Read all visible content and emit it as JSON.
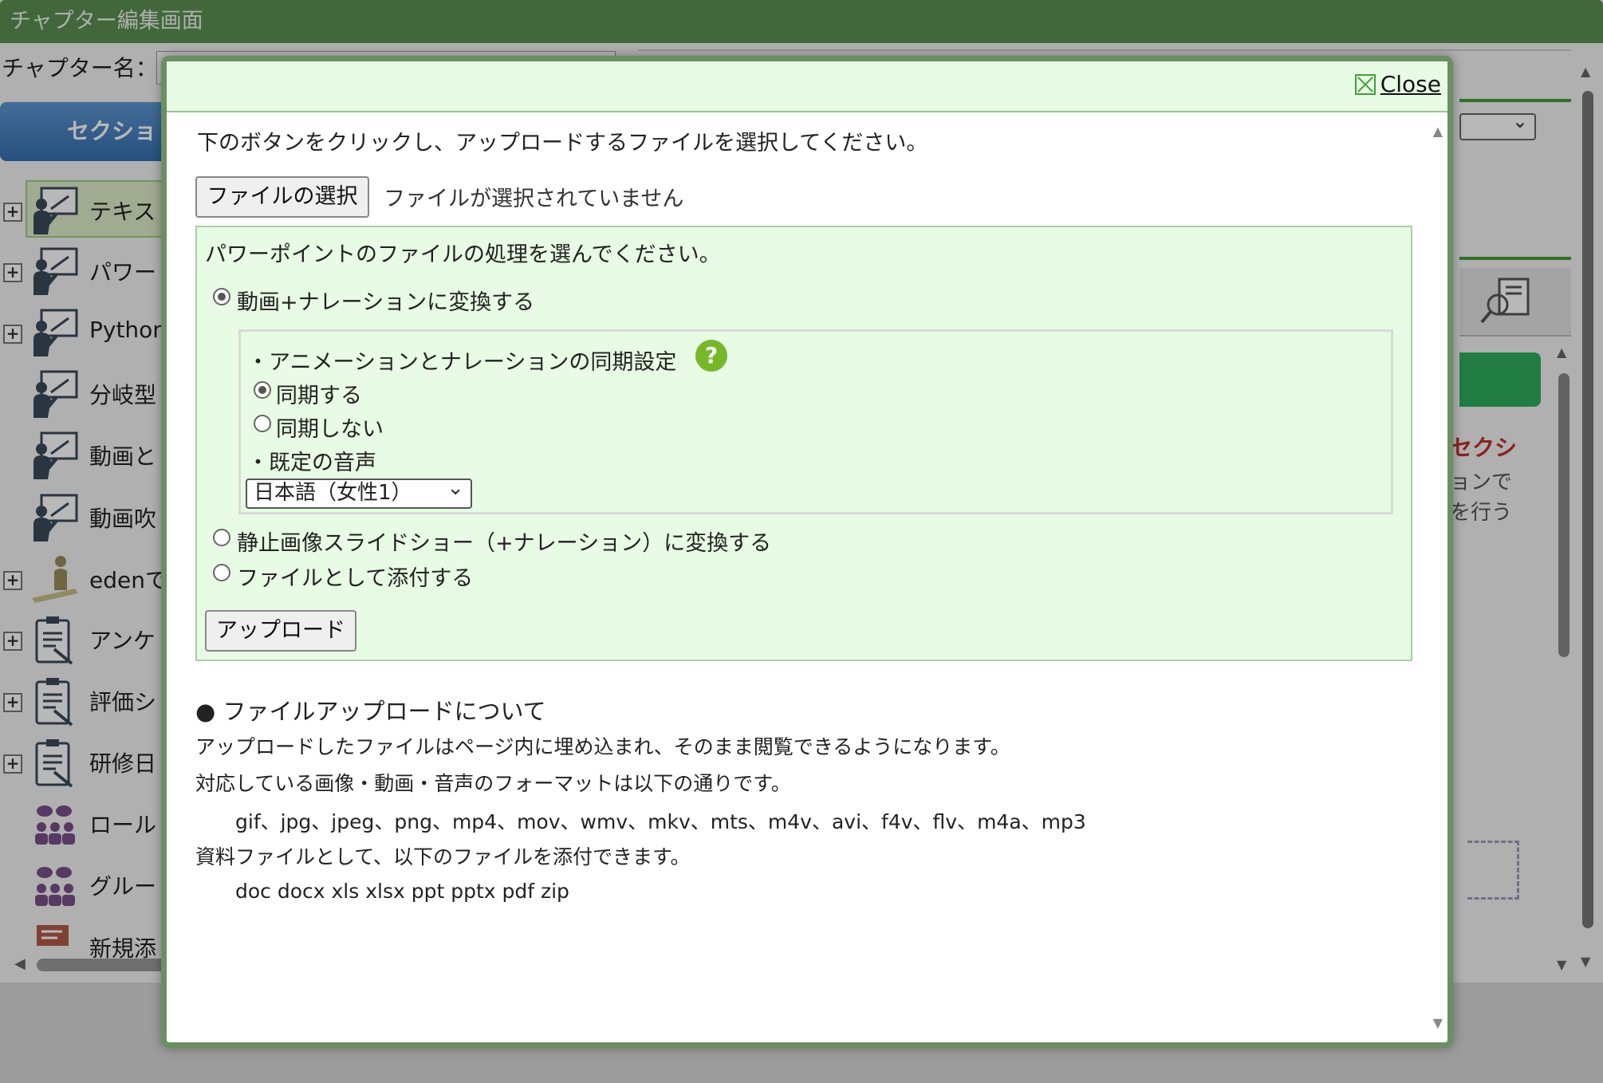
{
  "app": {
    "window_title": "チャプター編集画面",
    "chapter_label": "チャプター名：",
    "section_button": "セクショ"
  },
  "tree": {
    "items": [
      {
        "label": "テキス",
        "icon": "teacher-board-icon",
        "expandable": true,
        "selected": true
      },
      {
        "label": "パワー",
        "icon": "teacher-board-icon",
        "expandable": true
      },
      {
        "label": "Python",
        "icon": "teacher-board-icon",
        "expandable": true
      },
      {
        "label": "分岐型",
        "icon": "teacher-board-icon",
        "expandable": false
      },
      {
        "label": "動画と",
        "icon": "teacher-board-icon",
        "expandable": false
      },
      {
        "label": "動画吹",
        "icon": "teacher-board-icon",
        "expandable": false
      },
      {
        "label": "edenで",
        "icon": "person-desk-icon",
        "expandable": true
      },
      {
        "label": "アンケ",
        "icon": "clipboard-icon",
        "expandable": true
      },
      {
        "label": "評価シ",
        "icon": "clipboard-icon",
        "expandable": true
      },
      {
        "label": "研修日",
        "icon": "clipboard-icon",
        "expandable": true
      },
      {
        "label": "ロール",
        "icon": "group-chat-icon",
        "expandable": false
      },
      {
        "label": "グルー",
        "icon": "group-chat-icon",
        "expandable": false
      },
      {
        "label": "新規添",
        "icon": "document-icon",
        "expandable": false
      }
    ]
  },
  "right_panel": {
    "heading": "セクシ",
    "line1": "ョンで",
    "line2": "を行う"
  },
  "dialog": {
    "close_label": "Close",
    "instruction": "下のボタンをクリックし、アップロードするファイルを選択してください。",
    "file_button": "ファイルの選択",
    "file_status": "ファイルが選択されていません",
    "ppt": {
      "title": "パワーポイントのファイルの処理を選んでください。",
      "opt_video": "動画+ナレーションに変換する",
      "sync_title": "・アニメーションとナレーションの同期設定",
      "help_symbol": "?",
      "sync_on": "同期する",
      "sync_off": "同期しない",
      "voice_title": "・既定の音声",
      "voice_selected": "日本語（女性1）",
      "opt_slide": "静止画像スライドショー（+ナレーション）に変換する",
      "opt_attach": "ファイルとして添付する",
      "upload_button": "アップロード"
    },
    "info": {
      "title": "● ファイルアップロードについて",
      "line1": "アップロードしたファイルはページ内に埋め込まれ、そのまま閲覧できるようになります。",
      "line2": "対応している画像・動画・音声のフォーマットは以下の通りです。",
      "formats_media": "gif、jpg、jpeg、png、mp4、mov、wmv、mkv、mts、m4v、avi、f4v、flv、m4a、mp3",
      "line3": "資料ファイルとして、以下のファイルを添付できます。",
      "formats_docs": "doc docx xls xlsx ppt pptx pdf zip"
    }
  },
  "colors": {
    "titlebar": "#5a8f52",
    "dialog_border": "#6a8f62",
    "panel_bg": "#e8fbe4",
    "section_button": "#356fb0",
    "help_icon": "#76b82a"
  }
}
